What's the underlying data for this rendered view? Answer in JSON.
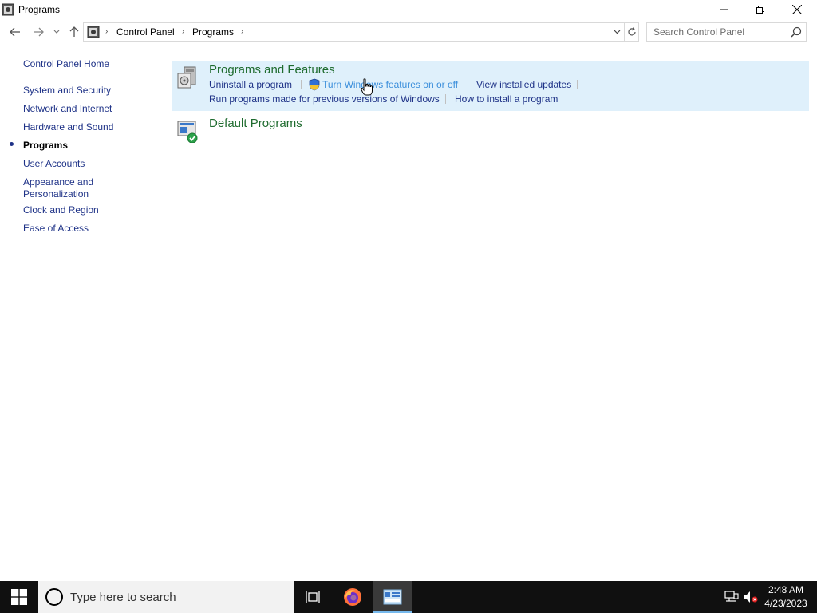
{
  "window": {
    "title": "Programs"
  },
  "address": {
    "crumbs": [
      "Control Panel",
      "Programs"
    ],
    "search_placeholder": "Search Control Panel"
  },
  "sidebar": {
    "home": "Control Panel Home",
    "items": [
      {
        "label": "System and Security"
      },
      {
        "label": "Network and Internet"
      },
      {
        "label": "Hardware and Sound"
      },
      {
        "label": "Programs",
        "active": true
      },
      {
        "label": "User Accounts"
      },
      {
        "label": "Appearance and",
        "label2": "Personalization"
      },
      {
        "label": "Clock and Region"
      },
      {
        "label": "Ease of Access"
      }
    ]
  },
  "categories": {
    "programs_features": {
      "title": "Programs and Features",
      "links": [
        "Uninstall a program",
        "Turn Windows features on or off",
        "View installed updates",
        "Run programs made for previous versions of Windows",
        "How to install a program"
      ]
    },
    "default_programs": {
      "title": "Default Programs"
    }
  },
  "taskbar": {
    "search_placeholder": "Type here to search",
    "time": "2:48 AM",
    "date": "4/23/2023"
  },
  "colors": {
    "link": "#1e3287",
    "category_title": "#1e6b2e",
    "hover_bg": "#dff0fb",
    "taskbar": "#101010"
  }
}
